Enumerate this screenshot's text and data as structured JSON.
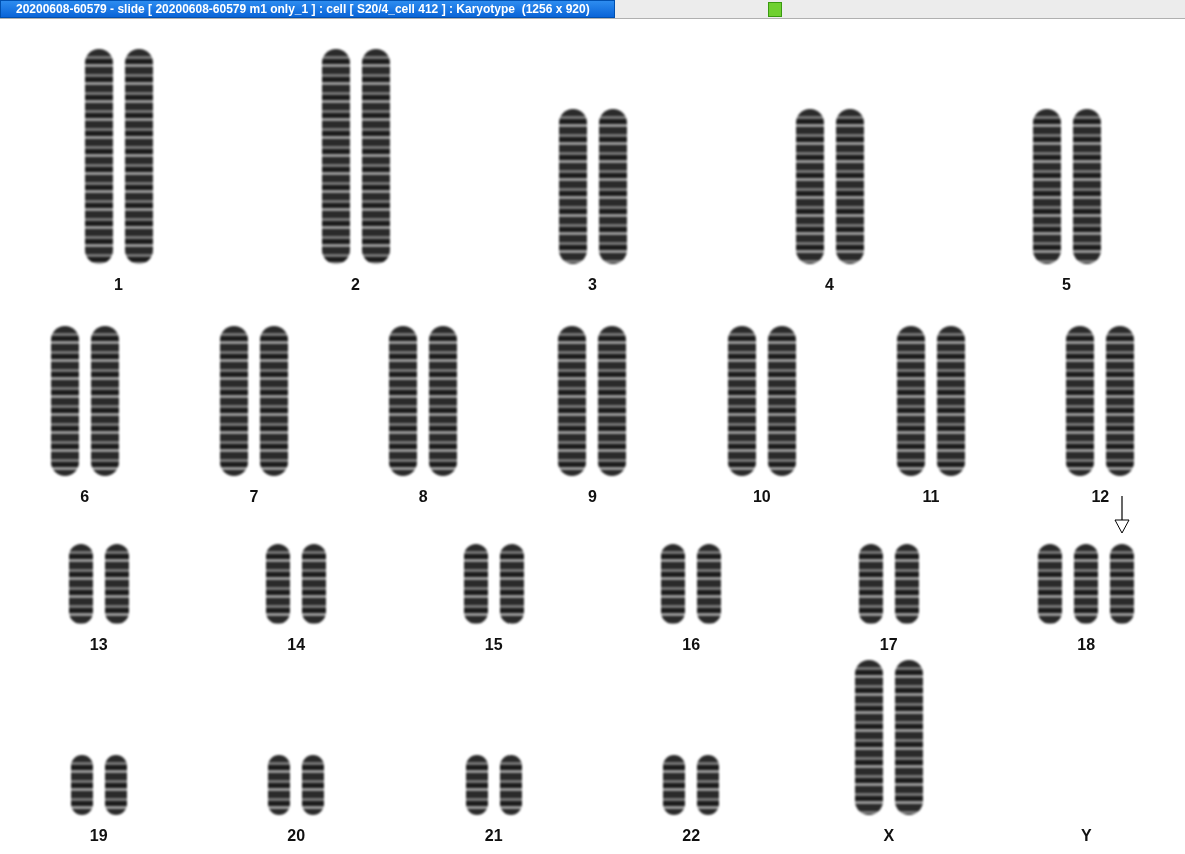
{
  "window": {
    "title": "20200608-60579 - slide [ 20200608-60579 m1 only_1 ] : cell [ S20/4_cell 412 ] : Karyotype  (1256 x 920)"
  },
  "rows": [
    {
      "groups": [
        {
          "label": "1",
          "kind": "xl",
          "chromosomes": [
            {
              "marked": false
            },
            {
              "marked": false
            }
          ]
        },
        {
          "label": "2",
          "kind": "xl",
          "chromosomes": [
            {
              "marked": false
            },
            {
              "marked": false
            }
          ]
        },
        {
          "label": "3",
          "kind": "l",
          "chromosomes": [
            {
              "marked": false
            },
            {
              "marked": false
            }
          ]
        },
        {
          "label": "4",
          "kind": "l",
          "chromosomes": [
            {
              "marked": false
            },
            {
              "marked": false
            }
          ]
        },
        {
          "label": "5",
          "kind": "l",
          "chromosomes": [
            {
              "marked": false
            },
            {
              "marked": false
            }
          ]
        }
      ]
    },
    {
      "groups": [
        {
          "label": "6",
          "kind": "m",
          "chromosomes": [
            {
              "marked": false
            },
            {
              "marked": false
            }
          ]
        },
        {
          "label": "7",
          "kind": "m",
          "chromosomes": [
            {
              "marked": false
            },
            {
              "marked": false
            }
          ]
        },
        {
          "label": "8",
          "kind": "m",
          "chromosomes": [
            {
              "marked": false
            },
            {
              "marked": false
            }
          ]
        },
        {
          "label": "9",
          "kind": "m",
          "chromosomes": [
            {
              "marked": false
            },
            {
              "marked": false
            }
          ]
        },
        {
          "label": "10",
          "kind": "m",
          "chromosomes": [
            {
              "marked": false
            },
            {
              "marked": false
            }
          ]
        },
        {
          "label": "11",
          "kind": "m",
          "chromosomes": [
            {
              "marked": false
            },
            {
              "marked": false
            }
          ]
        },
        {
          "label": "12",
          "kind": "m",
          "chromosomes": [
            {
              "marked": false
            },
            {
              "marked": false
            }
          ]
        }
      ]
    },
    {
      "groups": [
        {
          "label": "13",
          "kind": "s",
          "chromosomes": [
            {
              "marked": false
            },
            {
              "marked": false
            }
          ]
        },
        {
          "label": "14",
          "kind": "s",
          "chromosomes": [
            {
              "marked": false
            },
            {
              "marked": false
            }
          ]
        },
        {
          "label": "15",
          "kind": "s",
          "chromosomes": [
            {
              "marked": false
            },
            {
              "marked": false
            }
          ]
        },
        {
          "label": "16",
          "kind": "s",
          "chromosomes": [
            {
              "marked": false
            },
            {
              "marked": false
            }
          ]
        },
        {
          "label": "17",
          "kind": "s",
          "chromosomes": [
            {
              "marked": false
            },
            {
              "marked": false
            }
          ]
        },
        {
          "label": "18",
          "kind": "s",
          "chromosomes": [
            {
              "marked": false
            },
            {
              "marked": false
            },
            {
              "marked": true
            }
          ]
        }
      ]
    },
    {
      "groups": [
        {
          "label": "19",
          "kind": "xs",
          "chromosomes": [
            {
              "marked": false
            },
            {
              "marked": false
            }
          ]
        },
        {
          "label": "20",
          "kind": "xs",
          "chromosomes": [
            {
              "marked": false
            },
            {
              "marked": false
            }
          ]
        },
        {
          "label": "21",
          "kind": "xs",
          "chromosomes": [
            {
              "marked": false
            },
            {
              "marked": false
            }
          ]
        },
        {
          "label": "22",
          "kind": "xs",
          "chromosomes": [
            {
              "marked": false
            },
            {
              "marked": false
            }
          ]
        },
        {
          "label": "X",
          "kind": "l",
          "chromosomes": [
            {
              "marked": false
            },
            {
              "marked": false
            }
          ]
        },
        {
          "label": "Y",
          "kind": "xs"
        }
      ]
    }
  ]
}
